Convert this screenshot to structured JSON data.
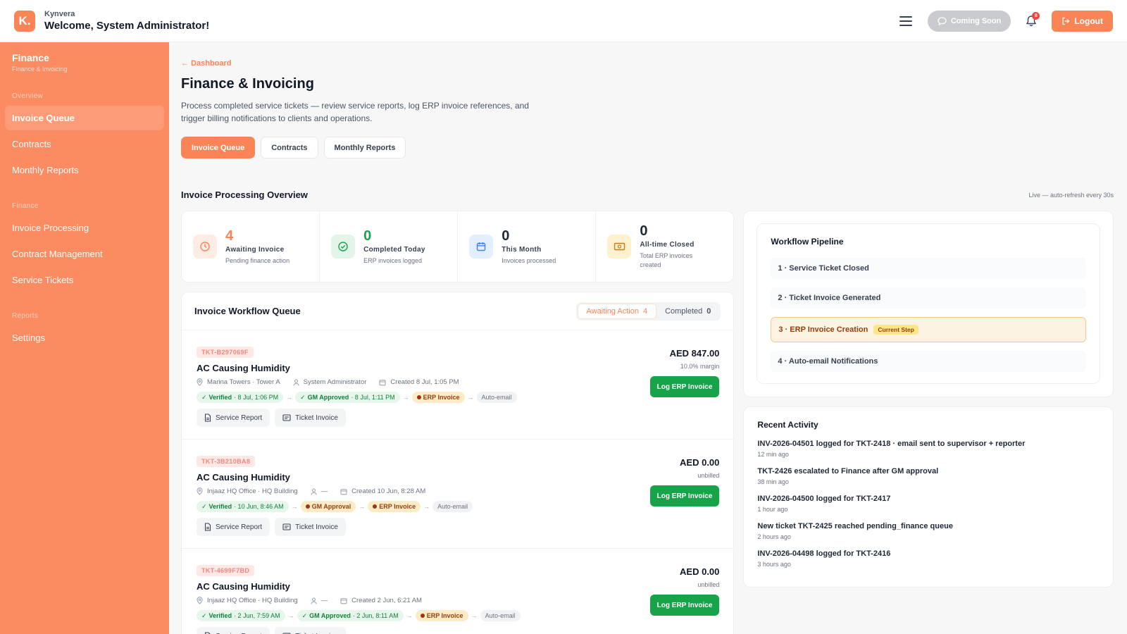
{
  "header": {
    "logo_letter": "K.",
    "company": "Kynvera",
    "welcome": "Welcome, System Administrator!",
    "coming_soon": "Coming Soon",
    "notification_count": "8",
    "logout": "Logout"
  },
  "sidebar": {
    "title": "Finance",
    "subtitle": "Finance & Invoicing",
    "sections": {
      "overview": "Overview",
      "finance": "Finance",
      "reports": "Reports"
    },
    "items": {
      "invoice_queue": "Invoice Queue",
      "contracts": "Contracts",
      "monthly_reports": "Monthly Reports",
      "invoice_processing": "Invoice Processing",
      "contract_management": "Contract Management",
      "service_tickets": "Service Tickets",
      "settings": "Settings"
    }
  },
  "main": {
    "back_link": "← Dashboard",
    "title": "Finance & Invoicing",
    "description": "Process completed service tickets — review service reports, log ERP invoice references, and trigger billing notifications to clients and operations.",
    "tabs": {
      "invoice_queue": "Invoice Queue",
      "contracts": "Contracts",
      "monthly_reports": "Monthly Reports"
    },
    "overview_title": "Invoice Processing Overview",
    "live_note": "Live — auto-refresh every 30s"
  },
  "stats": [
    {
      "value": "4",
      "label": "Awaiting Invoice",
      "sub": "Pending finance action",
      "color": "#f98456"
    },
    {
      "value": "0",
      "label": "Completed Today",
      "sub": "ERP invoices logged",
      "color": "#16a34a"
    },
    {
      "value": "0",
      "label": "This Month",
      "sub": "Invoices processed",
      "color": "#111827"
    },
    {
      "value": "0",
      "label": "All-time Closed",
      "sub": "Total ERP invoices created",
      "color": "#111827"
    }
  ],
  "queue": {
    "title": "Invoice Workflow Queue",
    "awaiting_label": "Awaiting Action",
    "awaiting_count": "4",
    "completed_label": "Completed",
    "completed_count": "0",
    "service_report_label": "Service Report",
    "ticket_invoice_label": "Ticket Invoice",
    "log_erp_label": "Log ERP Invoice",
    "tickets": [
      {
        "code": "TKT-B297069F",
        "title": "AC Causing Humidity",
        "location": "Marina Towers · Tower A",
        "assignee": "System Administrator",
        "created": "Created 8 Jul, 1:05 PM",
        "amount": "AED 847.00",
        "margin": "10.0% margin",
        "verified": "Verified",
        "verified_time": "· 8 Jul, 1:06 PM",
        "gm": "GM Approved",
        "gm_time": "· 8 Jul, 1:11 PM",
        "erp": "ERP Invoice",
        "auto": "Auto-email"
      },
      {
        "code": "TKT-3B210BA8",
        "title": "AC Causing Humidity",
        "location": "Injaaz HQ Office · HQ Building",
        "assignee": "—",
        "created": "Created 10 Jun, 8:28 AM",
        "amount": "AED 0.00",
        "margin": "unbilled",
        "verified": "Verified",
        "verified_time": "· 10 Jun, 8:46 AM",
        "gm": "GM Approval",
        "erp": "ERP Invoice",
        "auto": "Auto-email"
      },
      {
        "code": "TKT-4699F7BD",
        "title": "AC Causing Humidity",
        "location": "Injaaz HQ Office · HQ Building",
        "assignee": "—",
        "created": "Created 2 Jun, 6:21 AM",
        "amount": "AED 0.00",
        "margin": "unbilled",
        "verified": "Verified",
        "verified_time": "· 2 Jun, 7:59 AM",
        "gm": "GM Approved",
        "gm_time": "· 2 Jun, 8:11 AM",
        "erp": "ERP Invoice",
        "auto": "Auto-email"
      }
    ]
  },
  "pipeline": {
    "title": "Workflow Pipeline",
    "steps": [
      "1 · Service Ticket Closed",
      "2 · Ticket Invoice Generated",
      "3 · ERP Invoice Creation",
      "4 · Auto-email Notifications"
    ],
    "current_tag": "Current Step"
  },
  "activity": {
    "title": "Recent Activity",
    "items": [
      {
        "text": "INV-2026-04501 logged for TKT-2418 · email sent to supervisor + reporter",
        "time": "12 min ago"
      },
      {
        "text": "TKT-2426 escalated to Finance after GM approval",
        "time": "38 min ago"
      },
      {
        "text": "INV-2026-04500 logged for TKT-2417",
        "time": "1 hour ago"
      },
      {
        "text": "New ticket TKT-2425 reached pending_finance queue",
        "time": "2 hours ago"
      },
      {
        "text": "INV-2026-04498 logged for TKT-2416",
        "time": "3 hours ago"
      }
    ]
  },
  "colors": {
    "accent": "#f98456",
    "sidebar": "#fb8b61",
    "success": "#16a34a"
  }
}
